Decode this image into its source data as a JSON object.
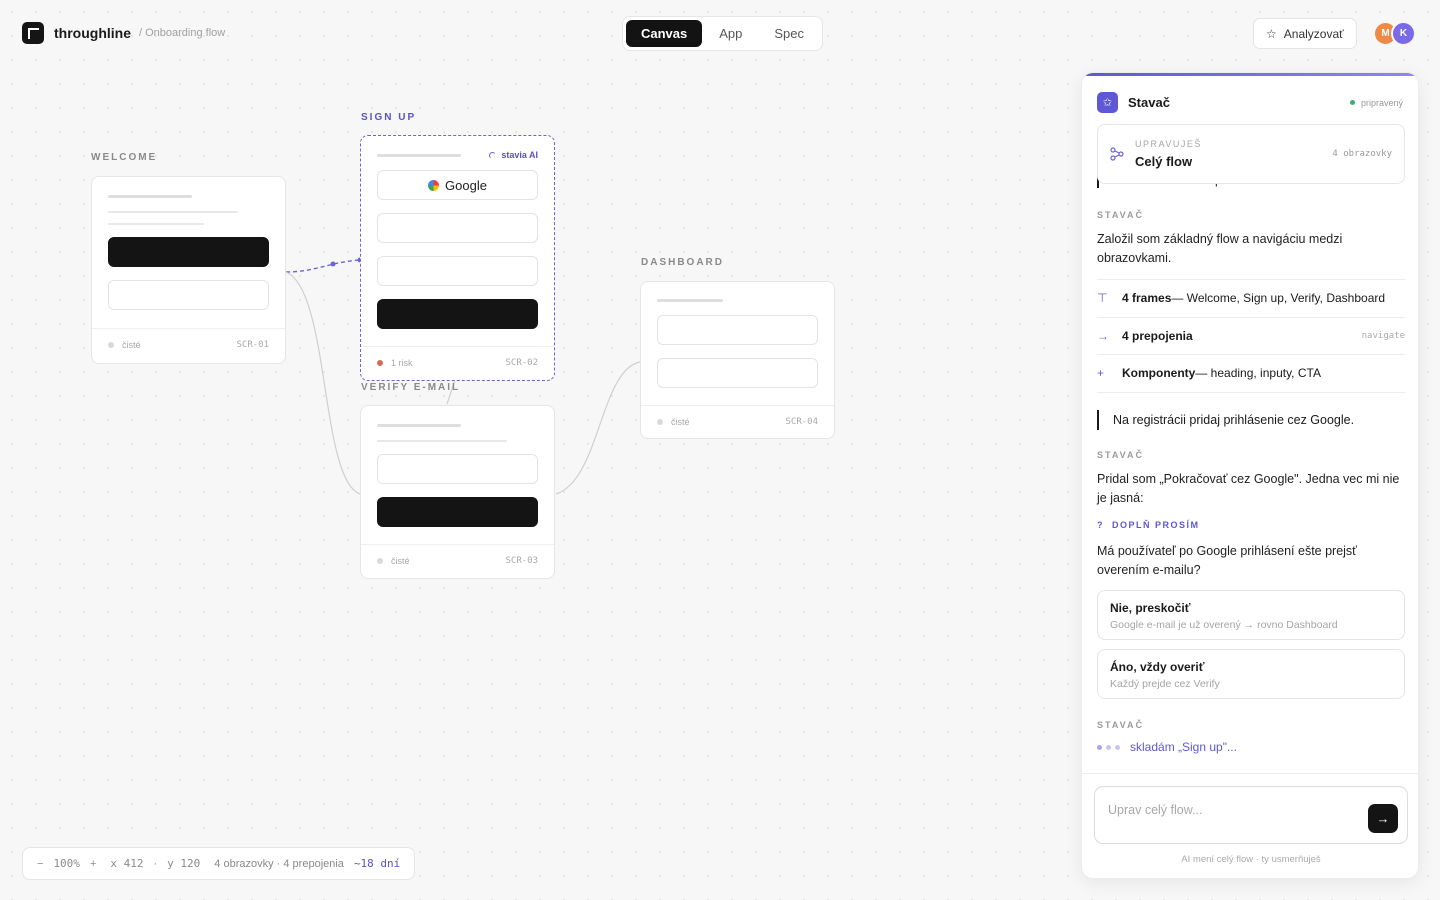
{
  "app": {
    "name": "throughline",
    "breadcrumb": "/ Onboarding flow"
  },
  "view_tabs": [
    {
      "label": "Canvas",
      "active": true
    },
    {
      "label": "App",
      "active": false
    },
    {
      "label": "Spec",
      "active": false
    }
  ],
  "toolbar": {
    "analyze_label": "Analyzovať",
    "avatars": [
      "M",
      "K"
    ]
  },
  "frames": {
    "welcome": {
      "label": "WELCOME",
      "status": "čisté",
      "id": "SCR-01"
    },
    "signup": {
      "label": "SIGN UP",
      "ai_tag": "stavia AI",
      "google_label": "Google",
      "status": "1 risk",
      "id": "SCR-02"
    },
    "verify": {
      "label": "VERIFY E-MAIL",
      "status": "čisté",
      "id": "SCR-03"
    },
    "dashboard": {
      "label": "DASHBOARD",
      "status": "čisté",
      "id": "SCR-04"
    }
  },
  "statusbar": {
    "zoom_minus": "−",
    "zoom": "100%",
    "zoom_plus": "+",
    "x": "x 412",
    "sep": "·",
    "y": "y 120",
    "summary": "4 obrazovky · 4 prepojenia",
    "eta": "~18 dní"
  },
  "panel": {
    "title": "Stavač",
    "state": "pripravený",
    "context": {
      "label": "UPRAVUJEŠ",
      "value": "Celý flow",
      "right": "4 obrazovky"
    },
    "cutoff_text": "overenie e-mailu a potom dashboard.",
    "messages": {
      "builder_role": "STAVAČ",
      "first_reply": "Založil som základný flow a navigáciu medzi obrazovkami.",
      "items": [
        {
          "icon": "⊤",
          "bold": "4 frames",
          "text": " — Welcome, Sign up, Verify, Dashboard",
          "tag": ""
        },
        {
          "icon": "→",
          "bold": "4 prepojenia",
          "text": "",
          "tag": "navigate"
        },
        {
          "icon": "+",
          "bold": "Komponenty",
          "text": " — heading, inputy, CTA",
          "tag": ""
        }
      ],
      "user_message": "Na registrácii pridaj prihlásenie cez Google.",
      "second_reply": "Pridal som „Pokračovať cez Google\". Jedna vec mi nie je jasná:",
      "ask_label": "DOPLŇ PROSÍM",
      "question": "Má používateľ po Google prihlásení ešte prejsť overením e-mailu?",
      "choices": [
        {
          "title": "Nie, preskočiť",
          "sub": "Google e-mail je už overený → rovno Dashboard"
        },
        {
          "title": "Áno, vždy overiť",
          "sub": "Každý prejde cez Verify"
        }
      ],
      "typing": "skladám „Sign up\"..."
    },
    "composer": {
      "placeholder": "Uprav celý flow...",
      "hint": "AI mení celý flow · ty usmerňuješ"
    }
  },
  "colors": {
    "accent": "#5e58d6",
    "dark": "#141414",
    "ok": "#3fae6a",
    "risk": "#d96a55"
  }
}
